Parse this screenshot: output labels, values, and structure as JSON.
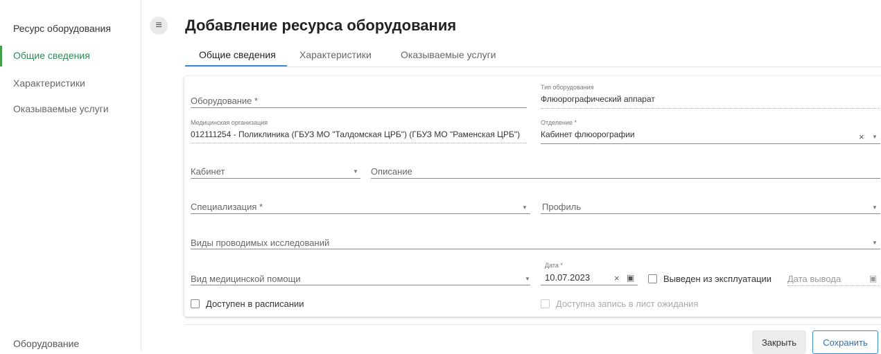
{
  "sidebar": {
    "title": "Ресурс оборудования",
    "items": [
      {
        "label": "Общие сведения"
      },
      {
        "label": "Характеристики"
      },
      {
        "label": "Оказываемые услуги"
      }
    ],
    "bottom_label": "Оборудование",
    "accent_color": "#43a047"
  },
  "header": {
    "menu_icon": "hamburger-icon",
    "title": "Добавление ресурса оборудования"
  },
  "tabs": [
    {
      "label": "Общие сведения",
      "active": true
    },
    {
      "label": "Характеристики",
      "active": false
    },
    {
      "label": "Оказываемые услуги",
      "active": false
    }
  ],
  "form": {
    "equipment": {
      "label": "Оборудование *",
      "value": ""
    },
    "equipment_type": {
      "label": "Тип оборудования",
      "value": "Флюорографический аппарат"
    },
    "med_org": {
      "label": "Медицинская организация",
      "value": "012111254 - Поликлиника (ГБУЗ МО \"Талдомская ЦРБ\") (ГБУЗ МО \"Раменская ЦРБ\")"
    },
    "department": {
      "label": "Отделение *",
      "value": "Кабинет флюорографии"
    },
    "cabinet": {
      "label": "Кабинет",
      "value": ""
    },
    "description": {
      "label": "Описание",
      "value": ""
    },
    "specialization": {
      "label": "Специализация *",
      "value": ""
    },
    "profile": {
      "label": "Профиль",
      "value": ""
    },
    "research_types": {
      "label": "Виды проводимых исследований",
      "value": ""
    },
    "care_type": {
      "label": "Вид медицинской помощи",
      "value": ""
    },
    "date": {
      "label": "Дата *",
      "value": "10.07.2023"
    },
    "decommissioned": {
      "label": "Выведен из эксплуатации",
      "checked": false
    },
    "decommission_date": {
      "label": "Дата вывода",
      "value": ""
    },
    "available_in_schedule": {
      "label": "Доступен в расписании",
      "checked": false
    },
    "waitlist": {
      "label": "Доступна запись в лист ожидания",
      "checked": false,
      "disabled": true
    }
  },
  "glyphs": {
    "caret": "▼",
    "clear": "×",
    "calendar": "▣"
  },
  "footer": {
    "close_label": "Закрыть",
    "save_label": "Сохранить"
  },
  "colors": {
    "tab_underline": "#3a8fd6",
    "save_border": "#3a8fd6"
  }
}
